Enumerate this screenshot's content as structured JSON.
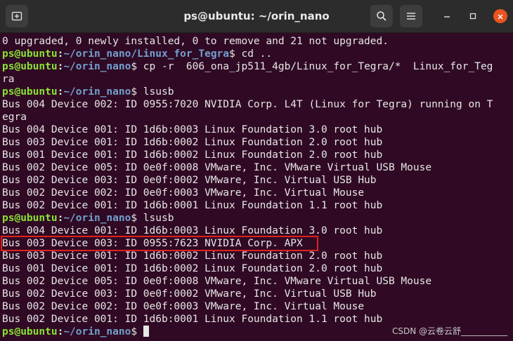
{
  "window": {
    "title": "ps@ubuntu: ~/orin_nano",
    "buttons": {
      "new_tab_icon": "new-tab-icon",
      "search_icon": "search-icon",
      "menu_icon": "hamburger-menu-icon"
    }
  },
  "prompt": {
    "user_host": "ps@ubuntu",
    "sep_colon": ":",
    "dollar": "$"
  },
  "lines": [
    "0 upgraded, 0 newly installed, 0 to remove and 21 not upgraded.",
    "",
    "",
    "ra",
    "",
    "Bus 004 Device 002: ID 0955:7020 NVIDIA Corp. L4T (Linux for Tegra) running on T",
    "egra",
    "Bus 004 Device 001: ID 1d6b:0003 Linux Foundation 3.0 root hub",
    "Bus 003 Device 001: ID 1d6b:0002 Linux Foundation 2.0 root hub",
    "Bus 001 Device 001: ID 1d6b:0002 Linux Foundation 2.0 root hub",
    "Bus 002 Device 005: ID 0e0f:0008 VMware, Inc. VMware Virtual USB Mouse",
    "Bus 002 Device 003: ID 0e0f:0002 VMware, Inc. Virtual USB Hub",
    "Bus 002 Device 002: ID 0e0f:0003 VMware, Inc. Virtual Mouse",
    "Bus 002 Device 001: ID 1d6b:0001 Linux Foundation 1.1 root hub",
    "",
    "Bus 004 Device 001: ID 1d6b:0003 Linux Foundation 3.0 root hub",
    "Bus 003 Device 003: ID 0955:7623 NVIDIA Corp. APX",
    "Bus 003 Device 001: ID 1d6b:0002 Linux Foundation 2.0 root hub",
    "Bus 001 Device 001: ID 1d6b:0002 Linux Foundation 2.0 root hub",
    "Bus 002 Device 005: ID 0e0f:0008 VMware, Inc. VMware Virtual USB Mouse",
    "Bus 002 Device 003: ID 0e0f:0002 VMware, Inc. Virtual USB Hub",
    "Bus 002 Device 002: ID 0e0f:0003 VMware, Inc. Virtual Mouse",
    "Bus 002 Device 001: ID 1d6b:0001 Linux Foundation 1.1 root hub"
  ],
  "prompts": [
    {
      "path": "~/orin_nano/Linux_for_Tegra",
      "cmd": " cd .."
    },
    {
      "path": "~/orin_nano",
      "cmd": " cp -r  606_ona_jp511_4gb/Linux_for_Tegra/*  Linux_for_Teg"
    },
    {
      "path": "~/orin_nano",
      "cmd": " lsusb"
    },
    {
      "path": "~/orin_nano",
      "cmd": " lsusb"
    },
    {
      "path": "~/orin_nano",
      "cmd": " "
    }
  ],
  "watermark": "CSDN @云卷云舒___________",
  "colors": {
    "terminal_bg": "#300a24",
    "prompt_user": "#8ae234",
    "prompt_path": "#729fcf",
    "highlight_border": "#e0201c",
    "close_button": "#e95420"
  }
}
